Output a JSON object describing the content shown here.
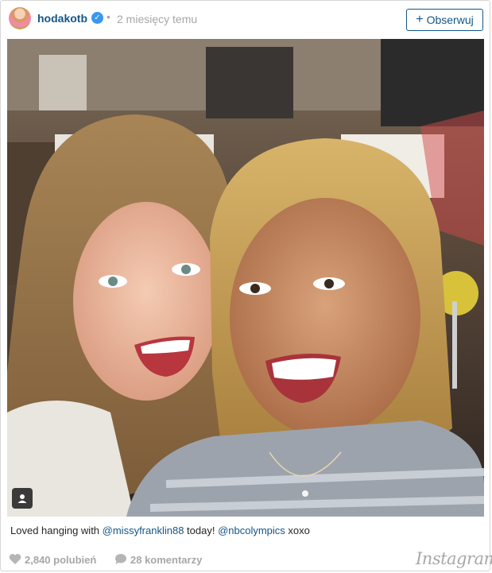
{
  "post": {
    "username": "hodakotb",
    "separator": "•",
    "timestamp": "2 miesięcy temu",
    "follow_label": "Obserwuj",
    "follow_plus": "+",
    "verified_glyph": "✓"
  },
  "photo": {
    "description_icon": "user-tag-icon"
  },
  "caption": {
    "prefix": "Loved hanging with ",
    "mention1": "@missyfranklin88",
    "middle": " today! ",
    "mention2": "@nbcolympics",
    "suffix": " xoxo"
  },
  "footer": {
    "likes": "2,840 polubień",
    "comments": "28 komentarzy",
    "logo": "Instagram"
  },
  "colors": {
    "link": "#125688",
    "muted": "#a5a7aa",
    "verified": "#3897f0"
  }
}
